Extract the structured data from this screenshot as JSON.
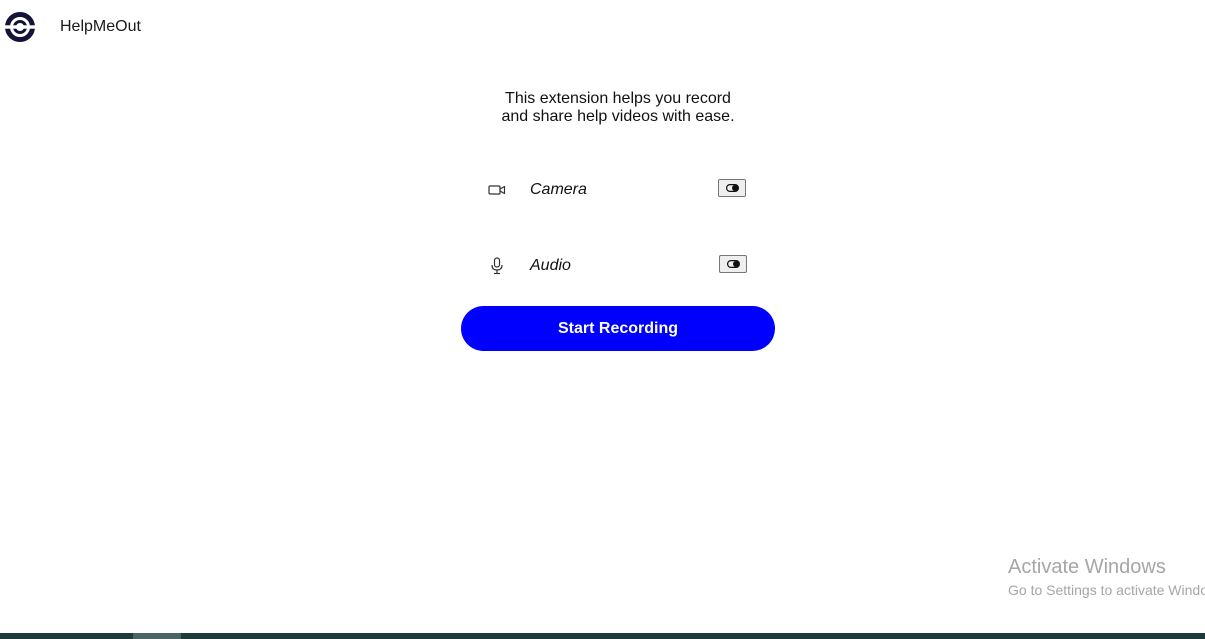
{
  "header": {
    "app_name": "HelpMeOut",
    "logo_icon": "helpmeout-logo-icon",
    "logo_color": "#14143a"
  },
  "main": {
    "description_line1": "This extension helps you record",
    "description_line2": "and share help videos with ease.",
    "options": [
      {
        "label": "Camera",
        "icon": "video-camera-icon",
        "enabled": false
      },
      {
        "label": "Audio",
        "icon": "microphone-icon",
        "enabled": false
      }
    ],
    "start_button": {
      "label": "Start Recording",
      "color": "#0000ff"
    }
  },
  "watermark": {
    "title": "Activate Windows",
    "subtitle": "Go to Settings to activate Windows."
  }
}
